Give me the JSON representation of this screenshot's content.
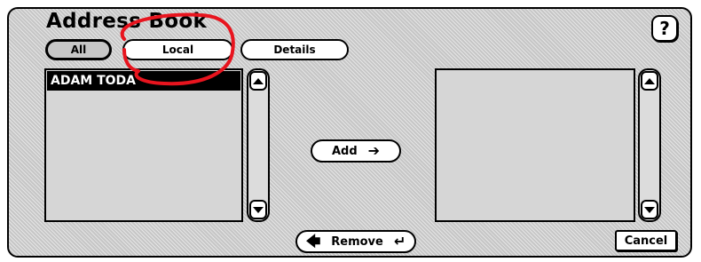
{
  "window": {
    "title": "Address Book"
  },
  "help": {
    "label": "?"
  },
  "tabs": [
    {
      "label": "All",
      "selected": true
    },
    {
      "label": "Local",
      "selected": false
    },
    {
      "label": "Details",
      "selected": false
    }
  ],
  "left_list": {
    "items": [
      "ADAM TODA"
    ],
    "selected_index": 0
  },
  "right_list": {
    "items": []
  },
  "actions": {
    "add_label": "Add",
    "remove_label": "Remove",
    "cancel_label": "Cancel"
  },
  "icons": {
    "add": "arrow-right-icon",
    "remove": "arrow-left-icon",
    "remove_trail": "return-arrow-icon",
    "scroll_up": "triangle-up-icon",
    "scroll_down": "triangle-down-icon"
  },
  "annotation": {
    "color": "#e8141e"
  }
}
